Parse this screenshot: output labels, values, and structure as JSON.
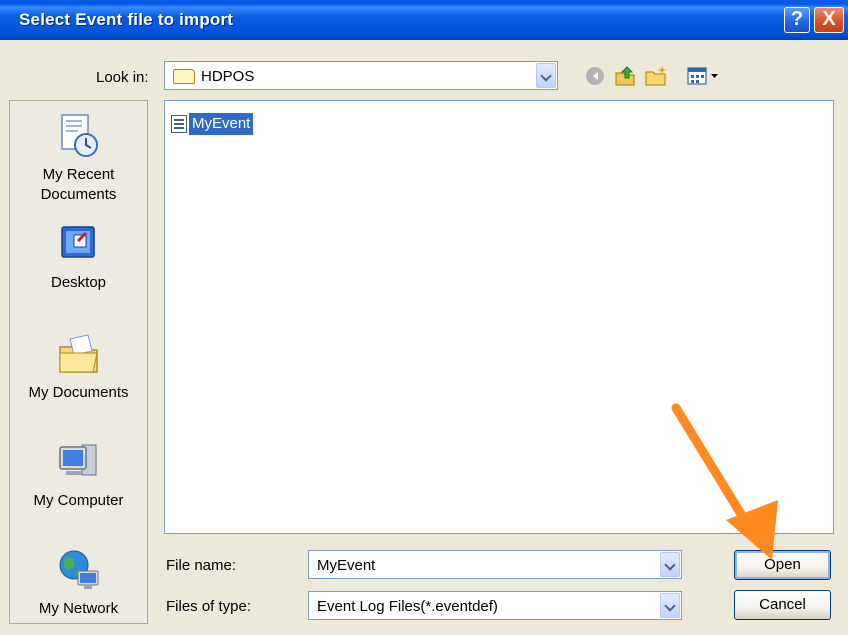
{
  "window": {
    "title": "Select Event file to import",
    "help_glyph": "?",
    "close_glyph": "X"
  },
  "lookin": {
    "label": "Look in:",
    "value": "HDPOS"
  },
  "places": [
    {
      "label": "My Recent Documents"
    },
    {
      "label": "Desktop"
    },
    {
      "label": "My Documents"
    },
    {
      "label": "My Computer"
    },
    {
      "label": "My Network"
    }
  ],
  "files": [
    {
      "name": "MyEvent",
      "selected": true
    }
  ],
  "filename": {
    "label": "File name:",
    "value": "MyEvent"
  },
  "filetype": {
    "label": "Files of type:",
    "value": "Event Log Files(*.eventdef)"
  },
  "buttons": {
    "open": "Open",
    "cancel": "Cancel"
  },
  "colors": {
    "titlebar": "#0A5FE0",
    "selection": "#316AC5",
    "annotation_arrow": "#FF8A1F"
  }
}
